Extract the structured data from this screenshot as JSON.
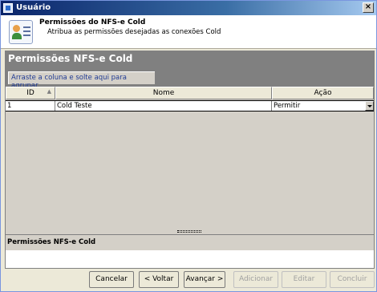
{
  "window": {
    "title": "Usuário"
  },
  "header": {
    "title": "Permissões do NFS-e Cold",
    "subtitle": "Atribua as permissões desejadas as conexões Cold"
  },
  "panel": {
    "title": "Permissões NFS-e Cold",
    "group_hint": "Arraste a coluna e solte aqui para agrupar",
    "columns": [
      "ID",
      "Nome",
      "Ação"
    ],
    "rows": [
      {
        "id": "1",
        "nome": "Cold Teste",
        "acao": "Permitir"
      }
    ],
    "description_title": "Permissões NFS-e Cold",
    "description_text": ""
  },
  "buttons": {
    "cancelar": "Cancelar",
    "voltar": "< Voltar",
    "avancar": "Avançar >",
    "adicionar": "Adicionar",
    "editar": "Editar",
    "concluir": "Concluir"
  }
}
